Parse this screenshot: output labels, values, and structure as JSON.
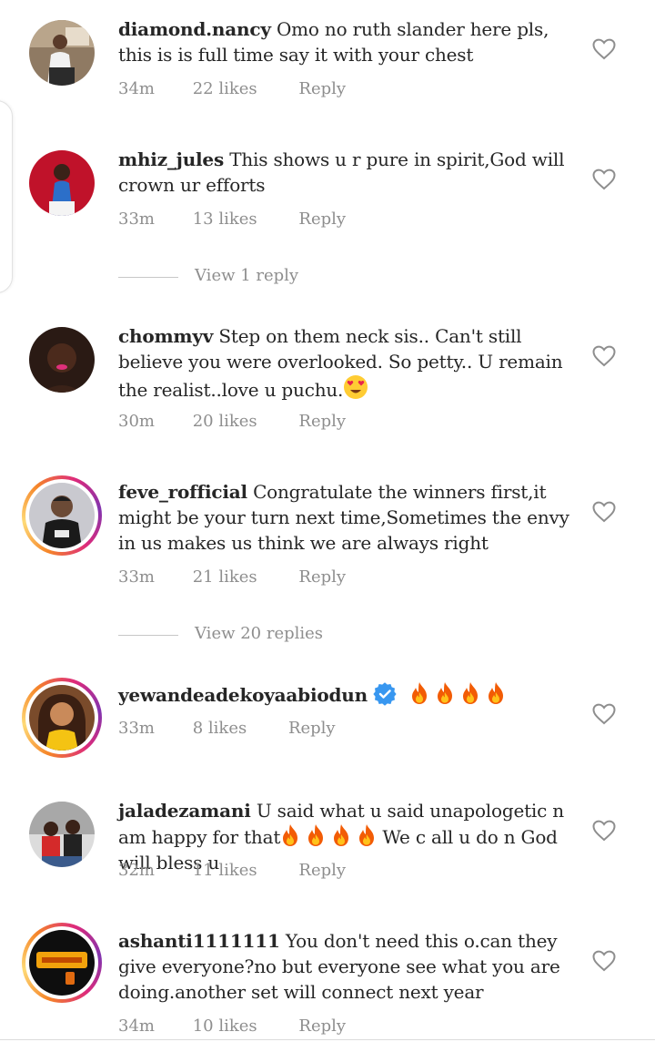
{
  "comments": [
    {
      "username": "diamond.nancy",
      "text": "Omo no ruth slander here pls, this is is full time say it with your chest",
      "time": "34m",
      "likes": "22 likes",
      "reply": "Reply"
    },
    {
      "username": "mhiz_jules",
      "text": "This shows u r pure in spirit,God will crown ur efforts",
      "time": "33m",
      "likes": "13 likes",
      "reply": "Reply",
      "view_replies": "View 1 reply"
    },
    {
      "username": "chommyv",
      "text": "Step on them neck sis.. Can't still believe you were overlooked. So petty.. U remain the realist..love u puchu.",
      "time": "30m",
      "likes": "20 likes",
      "reply": "Reply",
      "emoji": "heart-eyes-emoji"
    },
    {
      "username": "feve_rofficial",
      "text": "Congratulate the winners first,it might be your turn next time,Sometimes the envy in us makes us think we are always right",
      "time": "33m",
      "likes": "21 likes",
      "reply": "Reply",
      "view_replies": "View 20 replies"
    },
    {
      "username": "yewandeadekoyaabiodun",
      "text": "",
      "time": "33m",
      "likes": "8 likes",
      "reply": "Reply",
      "verified": true,
      "emoji": "fire-emoji x4"
    },
    {
      "username": "jaladezamani",
      "text_a": "U said what u said unapologetic n am happy for that",
      "text_b": " We c all u do n God will bless u",
      "time": "32m",
      "likes": "11 likes",
      "reply": "Reply",
      "emoji": "fire-emoji x4"
    },
    {
      "username": "ashanti1111111",
      "text": "You don't need this o.can they  give everyone?no but everyone see what you are doing.another set will connect next year",
      "time": "34m",
      "likes": "10 likes",
      "reply": "Reply"
    }
  ],
  "colors": {
    "text": "#262626",
    "meta": "#8e8e8e",
    "verified": "#3897f0",
    "divider": "#c7c7c7"
  },
  "icons": [
    "heart-outline-icon",
    "verified-badge-icon",
    "fire-emoji",
    "heart-eyes-emoji"
  ]
}
